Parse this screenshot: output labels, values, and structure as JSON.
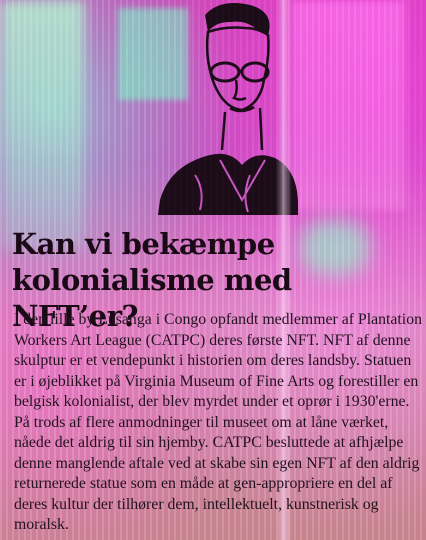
{
  "image": {
    "description_icon": "portrait-drawing-icon",
    "colors": {
      "magenta": "#d04ab8",
      "mint": "#8effd0",
      "ink": "#1a0a16"
    }
  },
  "headline": {
    "line1": "Kan vi bekæmpe",
    "line2": "kolonialisme med NFT’er?"
  },
  "body": {
    "paragraph": "I den lille by Lusanga i Congo opfandt medlemmer af Plantation Workers Art League (CATPC) deres første NFT. NFT af denne skulptur er et vendepunkt i historien om deres landsby. Statuen er i øjeblikket på Virginia Museum of Fine Arts og forestiller en belgisk kolonialist, der blev myrdet under et oprør i 1930'erne. På trods af flere anmodninger til museet om at låne værket, nåede det aldrig til sin hjemby. CATPC besluttede at afhjælpe denne manglende aftale ved at skabe sin egen NFT af den aldrig returnerede statue som en måde at gen-approprierе en del af deres kultur der tilhører dem, intellektuelt, kunstnerisk og moralsk."
  }
}
